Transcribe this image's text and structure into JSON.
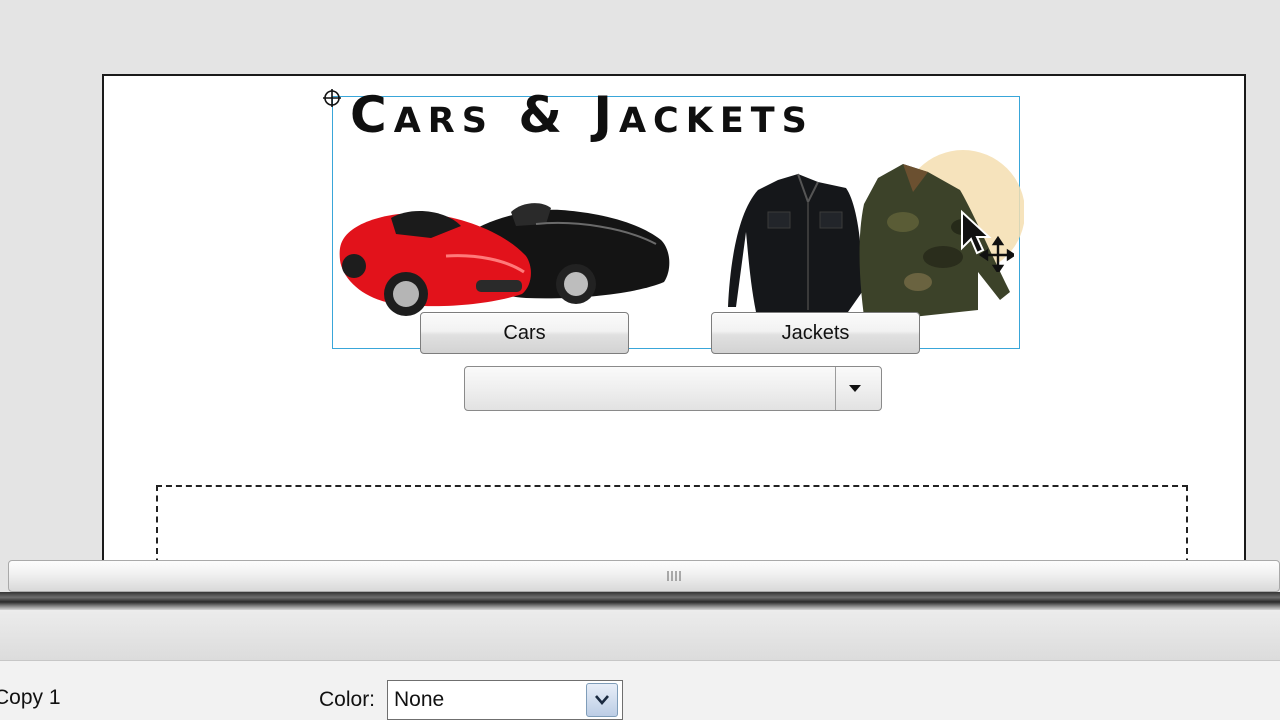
{
  "stage": {
    "banner": {
      "title": "Cars & Jackets",
      "buttons": {
        "cars": "Cars",
        "jackets": "Jackets"
      },
      "combo_value": ""
    }
  },
  "properties": {
    "instance_label": "Copy 1",
    "color_label": "Color:",
    "color_value": "None"
  },
  "colors": {
    "selection_outline": "#39a6d9",
    "stage_border": "#1a1a1a",
    "highlight_glow": "#f5deb0"
  },
  "icons": [
    "registration-point-icon",
    "dropdown-arrow-icon",
    "splitter-grip-icon",
    "move-cursor-icon"
  ]
}
